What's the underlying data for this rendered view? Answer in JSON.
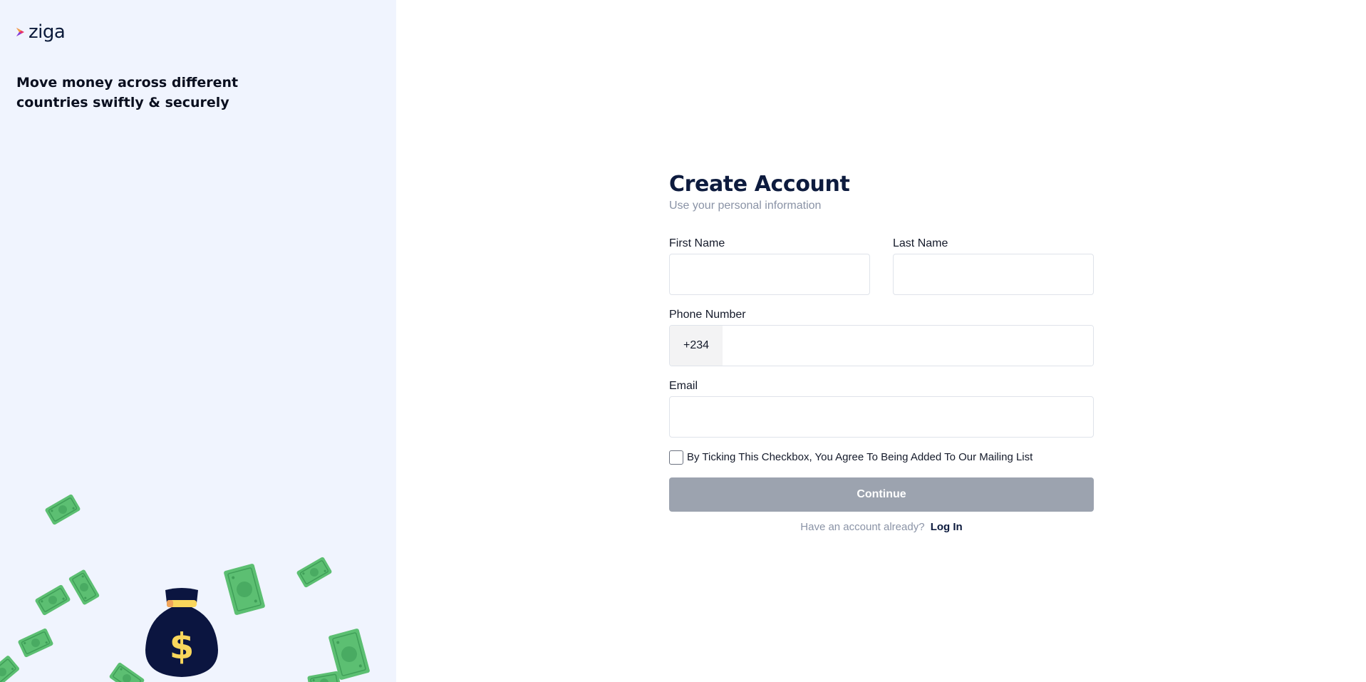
{
  "brand": {
    "name": "ziga",
    "tagline_lines": [
      "Move money across different",
      "countries swiftly & securely"
    ]
  },
  "illustration": {
    "bag_symbol": "$",
    "icons": [
      "money-bag-icon",
      "banknote-icon"
    ]
  },
  "form": {
    "title": "Create Account",
    "subtitle": "Use your personal information",
    "first_name": {
      "label": "First Name",
      "value": "",
      "placeholder": ""
    },
    "last_name": {
      "label": "Last Name",
      "value": "",
      "placeholder": ""
    },
    "phone": {
      "label": "Phone Number",
      "prefix": "+234",
      "value": "",
      "placeholder": ""
    },
    "email": {
      "label": "Email",
      "value": "",
      "placeholder": ""
    },
    "consent": {
      "label": "By Ticking This Checkbox, You Agree To Being Added To Our Mailing List",
      "checked": false
    },
    "continue_label": "Continue",
    "footer_text": "Have an account already?",
    "login_label": "Log In"
  },
  "colors": {
    "panel_bg": "#f0f4fe",
    "navy": "#0d1b3e",
    "button_disabled": "#9ca3af",
    "money_green": "#5cbf72",
    "bag_band": "#f9d65c"
  }
}
